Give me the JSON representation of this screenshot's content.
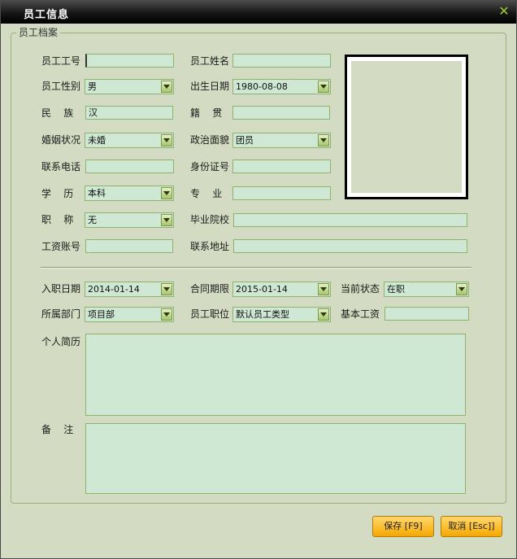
{
  "window": {
    "title": "员工信息"
  },
  "group": {
    "legend": "员工档案"
  },
  "fields": {
    "emp_id": {
      "label": "员工工号",
      "value": ""
    },
    "emp_name": {
      "label": "员工姓名",
      "value": ""
    },
    "gender": {
      "label": "员工性别",
      "value": "男"
    },
    "birth": {
      "label": "出生日期",
      "value": "1980-08-08"
    },
    "ethnicity": {
      "label": "民    族",
      "value": "汉"
    },
    "native": {
      "label": "籍    贯",
      "value": ""
    },
    "marital": {
      "label": "婚姻状况",
      "value": "未婚"
    },
    "political": {
      "label": "政治面貌",
      "value": "团员"
    },
    "phone": {
      "label": "联系电话",
      "value": ""
    },
    "idcard": {
      "label": "身份证号",
      "value": ""
    },
    "education": {
      "label": "学    历",
      "value": "本科"
    },
    "major": {
      "label": "专    业",
      "value": ""
    },
    "title": {
      "label": "职    称",
      "value": "无"
    },
    "school": {
      "label": "毕业院校",
      "value": ""
    },
    "salary_acct": {
      "label": "工资账号",
      "value": ""
    },
    "address": {
      "label": "联系地址",
      "value": ""
    },
    "hire_date": {
      "label": "入职日期",
      "value": "2014-01-14"
    },
    "contract": {
      "label": "合同期限",
      "value": "2015-01-14"
    },
    "status": {
      "label": "当前状态",
      "value": "在职"
    },
    "dept": {
      "label": "所属部门",
      "value": "项目部"
    },
    "position": {
      "label": "员工职位",
      "value": "默认员工类型"
    },
    "base_salary": {
      "label": "基本工资",
      "value": ""
    },
    "resume": {
      "label": "个人简历",
      "value": ""
    },
    "remark": {
      "label": "备    注",
      "value": ""
    }
  },
  "buttons": {
    "save": "保存 [F9]",
    "cancel": "取消 [Esc]]"
  },
  "colors": {
    "input_bg": "#cfe8d4",
    "window_bg": "#d3dcc2",
    "button": "#f6a800",
    "close": "#9acd32"
  },
  "icons": {
    "close": "close-icon",
    "dropdown": "chevron-down-icon"
  }
}
